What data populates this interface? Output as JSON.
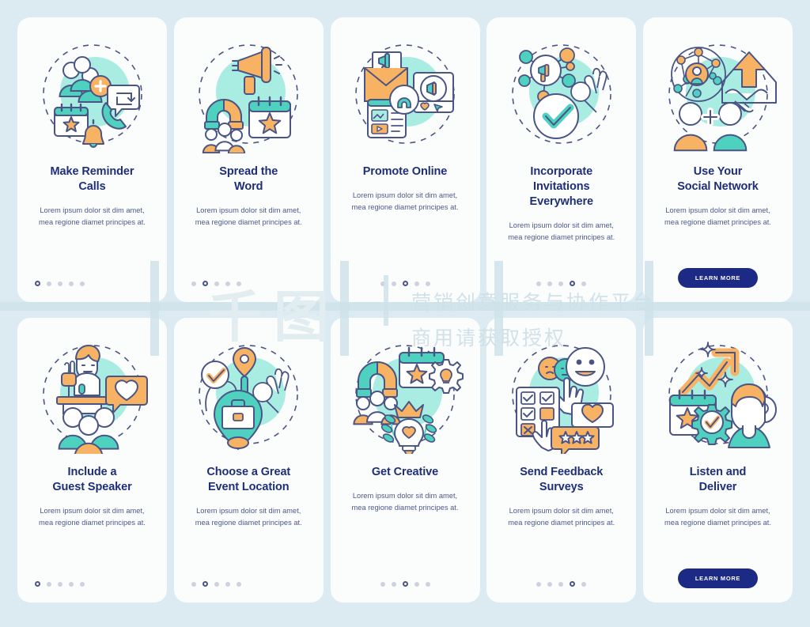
{
  "page": {
    "background_color": "#dceaf1",
    "card_color": "#fbfcfc",
    "title_color": "#1e2f78",
    "body_color": "#4c5a8a",
    "accent_teal": "#4fd1c0",
    "accent_teal_light": "#a8ece2",
    "accent_orange": "#f7b263",
    "accent_navy": "#1c2a86",
    "outline_color": "#4a5585",
    "dot_inactive": "#cfd2de",
    "cta_label": "LEARN MORE",
    "dot_count": 5
  },
  "watermark": {
    "logo": "千图",
    "line1": "营销创意服务与协作平台",
    "line2": "商用请获取授权"
  },
  "cards": [
    {
      "id": "make-reminder-calls",
      "title": "Make Reminder\nCalls",
      "description": "Lorem ipsum dolor sit dim amet, mea regione diamet principes at.",
      "active_dot": 1,
      "has_cta": false,
      "icon": "people-add-calendar-bell-phone",
      "dots_align": "left"
    },
    {
      "id": "spread-the-word",
      "title": "Spread the\nWord",
      "description": "Lorem ipsum dolor sit dim amet, mea regione diamet principes at.",
      "active_dot": 2,
      "has_cta": false,
      "icon": "megaphone-magnet-calendar-star",
      "dots_align": "left"
    },
    {
      "id": "promote-online",
      "title": "Promote Online",
      "description": "Lorem ipsum dolor sit dim amet, mea regione diamet principes at.",
      "active_dot": 3,
      "has_cta": false,
      "icon": "envelope-megaphone-media-post",
      "dots_align": "center"
    },
    {
      "id": "incorporate-invitations-everywhere",
      "title": "Incorporate\nInvitations\nEverywhere",
      "description": "Lorem ipsum dolor sit dim amet, mea regione diamet principes at.",
      "active_dot": 4,
      "has_cta": false,
      "icon": "network-megaphone-check-hand",
      "dots_align": "center"
    },
    {
      "id": "use-your-social-network",
      "title": "Use Your\nSocial Network",
      "description": "Lorem ipsum dolor sit dim amet, mea regione diamet principes at.",
      "active_dot": 5,
      "has_cta": true,
      "icon": "network-handshake-arrow-people",
      "dots_align": "center"
    },
    {
      "id": "include-a-guest-speaker",
      "title": "Include a\nGuest Speaker",
      "description": "Lorem ipsum dolor sit dim amet, mea regione diamet principes at.",
      "active_dot": 1,
      "has_cta": false,
      "icon": "speaker-podium-audience-heart",
      "dots_align": "left"
    },
    {
      "id": "choose-a-great-event-location",
      "title": "Choose a Great\nEvent Location",
      "description": "Lorem ipsum dolor sit dim amet, mea regione diamet principes at.",
      "active_dot": 2,
      "has_cta": false,
      "icon": "map-pin-briefcase-check-hand",
      "dots_align": "left"
    },
    {
      "id": "get-creative",
      "title": "Get Creative",
      "description": "Lorem ipsum dolor sit dim amet, mea regione diamet principes at.",
      "active_dot": 3,
      "has_cta": false,
      "icon": "magnet-calendar-gear-bulb-crown",
      "dots_align": "center"
    },
    {
      "id": "send-feedback-surveys",
      "title": "Send Feedback\nSurveys",
      "description": "Lorem ipsum dolor sit dim amet, mea regione diamet principes at.",
      "active_dot": 4,
      "has_cta": false,
      "icon": "survey-checklist-smiley-rating",
      "dots_align": "center"
    },
    {
      "id": "listen-and-deliver",
      "title": "Listen and\nDeliver",
      "description": "Lorem ipsum dolor sit dim amet, mea regione diamet principes at.",
      "active_dot": 5,
      "has_cta": true,
      "icon": "growth-arrow-calendar-gear-listener",
      "dots_align": "center"
    }
  ]
}
